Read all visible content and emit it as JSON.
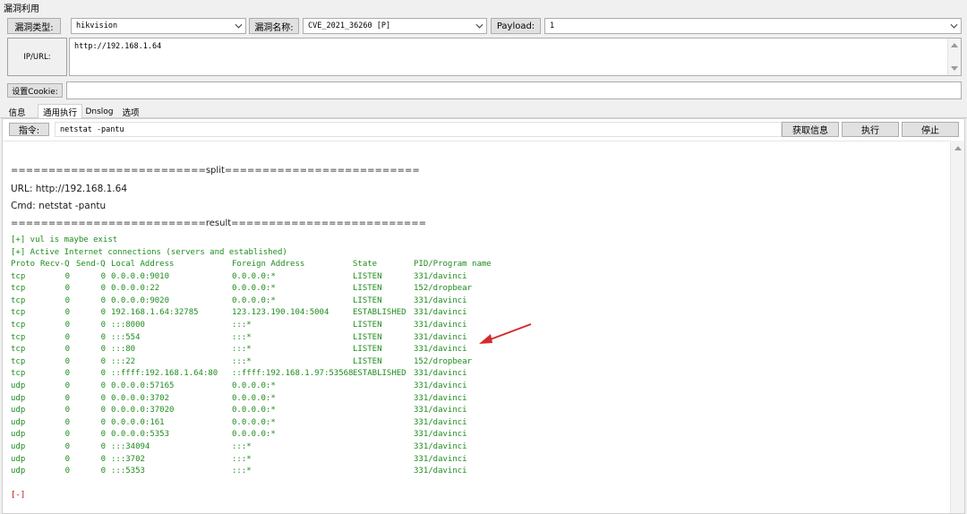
{
  "window": {
    "title": "漏洞利用"
  },
  "vuln_type": {
    "label": "漏洞类型:",
    "value": "hikvision"
  },
  "vuln_name": {
    "label": "漏洞名称:",
    "value": "CVE_2021_36260 [P]"
  },
  "payload": {
    "label": "Payload:",
    "value": "1"
  },
  "ip_url": {
    "label": "IP/URL:",
    "value": "http://192.168.1.64"
  },
  "cookie": {
    "label": "设置Cookie:",
    "value": ""
  },
  "tabs": [
    {
      "label": "信息"
    },
    {
      "label": "通用执行"
    },
    {
      "label": "Dnslog"
    },
    {
      "label": "选项"
    }
  ],
  "command": {
    "label": "指令:",
    "value": "netstat -pantu",
    "fetch_label": "获取信息",
    "exec_label": "执行",
    "stop_label": "停止"
  },
  "output": {
    "split_line": "==========================split==========================",
    "url_line": "URL: http://192.168.1.64",
    "cmd_line": "Cmd: netstat -pantu",
    "result_line": "==========================result==========================",
    "maybe_exist": "[+] vul is maybe exist",
    "active_conn": "[+] Active Internet connections (servers and established)",
    "headers": [
      "Proto",
      "Recv-Q",
      "Send-Q",
      "Local Address",
      "Foreign Address",
      "State",
      "PID/Program name"
    ],
    "rows": [
      [
        "tcp",
        "0",
        "0",
        "0.0.0.0:9010",
        "0.0.0.0:*",
        "LISTEN",
        "331/davinci"
      ],
      [
        "tcp",
        "0",
        "0",
        "0.0.0.0:22",
        "0.0.0.0:*",
        "LISTEN",
        "152/dropbear"
      ],
      [
        "tcp",
        "0",
        "0",
        "0.0.0.0:9020",
        "0.0.0.0:*",
        "LISTEN",
        "331/davinci"
      ],
      [
        "tcp",
        "0",
        "0",
        "192.168.1.64:32785",
        "123.123.190.104:5004",
        "ESTABLISHED",
        "331/davinci"
      ],
      [
        "tcp",
        "0",
        "0",
        ":::8000",
        ":::*",
        "LISTEN",
        "331/davinci"
      ],
      [
        "tcp",
        "0",
        "0",
        ":::554",
        ":::*",
        "LISTEN",
        "331/davinci"
      ],
      [
        "tcp",
        "0",
        "0",
        ":::80",
        ":::*",
        "LISTEN",
        "331/davinci"
      ],
      [
        "tcp",
        "0",
        "0",
        ":::22",
        ":::*",
        "LISTEN",
        "152/dropbear"
      ],
      [
        "tcp",
        "0",
        "0",
        "::ffff:192.168.1.64:80",
        "::ffff:192.168.1.97:53568",
        "ESTABLISHED",
        "331/davinci"
      ],
      [
        "udp",
        "0",
        "0",
        "0.0.0.0:57165",
        "0.0.0.0:*",
        "",
        "331/davinci"
      ],
      [
        "udp",
        "0",
        "0",
        "0.0.0.0:3702",
        "0.0.0.0:*",
        "",
        "331/davinci"
      ],
      [
        "udp",
        "0",
        "0",
        "0.0.0.0:37020",
        "0.0.0.0:*",
        "",
        "331/davinci"
      ],
      [
        "udp",
        "0",
        "0",
        "0.0.0.0:161",
        "0.0.0.0:*",
        "",
        "331/davinci"
      ],
      [
        "udp",
        "0",
        "0",
        "0.0.0.0:5353",
        "0.0.0.0:*",
        "",
        "331/davinci"
      ],
      [
        "udp",
        "0",
        "0",
        ":::34094",
        ":::*",
        "",
        "331/davinci"
      ],
      [
        "udp",
        "0",
        "0",
        ":::3702",
        ":::*",
        "",
        "331/davinci"
      ],
      [
        "udp",
        "0",
        "0",
        ":::5353",
        ":::*",
        "",
        "331/davinci"
      ]
    ],
    "end_marker": "[-]"
  },
  "colors": {
    "output_green": "#1e8c1e",
    "output_red": "#d00000",
    "arrow": "#d42b2b"
  },
  "icons": {
    "dropdown": "chevron-down-icon",
    "scroll_up": "scroll-up-arrow-icon",
    "annotation": "red-arrow-icon"
  }
}
